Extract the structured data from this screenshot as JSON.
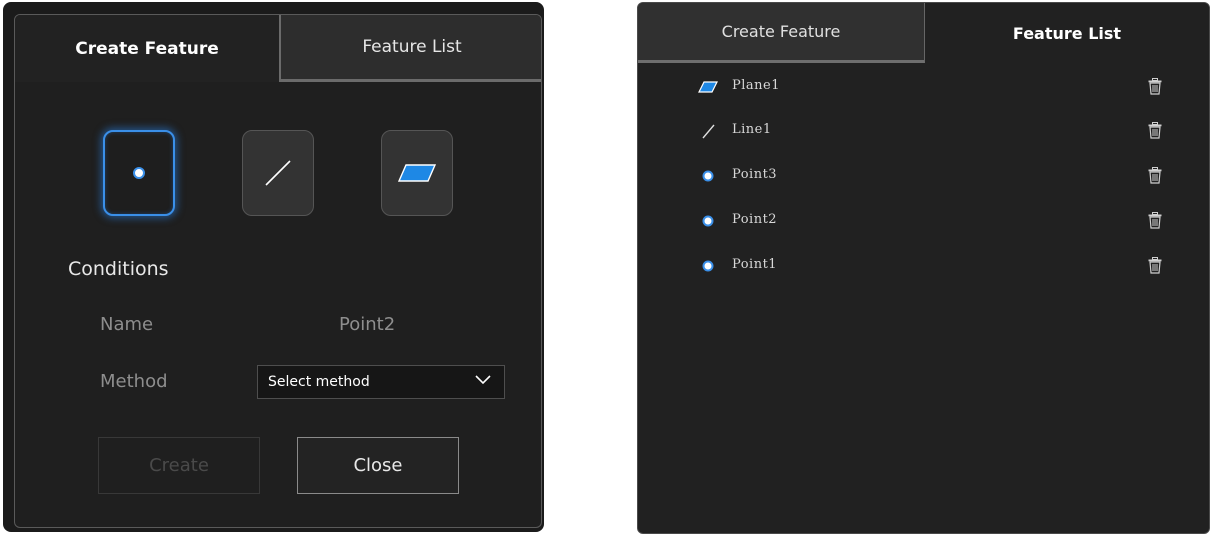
{
  "create_panel": {
    "tabs": {
      "active": "Create Feature",
      "inactive": "Feature List"
    },
    "types": [
      "point-type-icon",
      "line-type-icon",
      "plane-type-icon"
    ],
    "selected_type": "point",
    "conditions_title": "Conditions",
    "name_label": "Name",
    "name_value": "Point2",
    "method_label": "Method",
    "method_select": "Select method",
    "create_button": "Create",
    "close_button": "Close"
  },
  "list_panel": {
    "tabs": {
      "inactive": "Create Feature",
      "active": "Feature List"
    },
    "features": [
      {
        "name": "Plane1",
        "type": "plane"
      },
      {
        "name": "Line1",
        "type": "line"
      },
      {
        "name": "Point3",
        "type": "point"
      },
      {
        "name": "Point2",
        "type": "point"
      },
      {
        "name": "Point1",
        "type": "point"
      }
    ],
    "delete_icon": "trash-icon"
  },
  "colors": {
    "accent": "#3a8fe8",
    "panel_bg": "#1f1f1f",
    "text": "#e8e8e8",
    "muted": "#8e8e8e"
  }
}
